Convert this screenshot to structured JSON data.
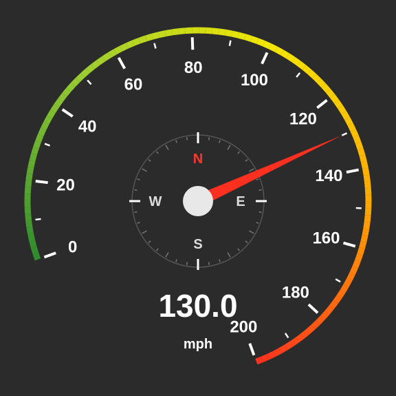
{
  "chart_data": {
    "type": "gauge",
    "title": "",
    "value": 130.0,
    "value_label": "130.0",
    "unit": "mph",
    "range": [
      0,
      200
    ],
    "major_ticks": [
      0,
      20,
      40,
      60,
      80,
      100,
      120,
      140,
      160,
      180,
      200
    ],
    "tick_labels": [
      "0",
      "20",
      "40",
      "60",
      "80",
      "100",
      "120",
      "140",
      "160",
      "180",
      "200"
    ],
    "minor_step": 10,
    "arc_start_deg": 200,
    "arc_end_deg": -70,
    "gradient_stops": [
      {
        "t": 0.0,
        "color": "#2e8b2e"
      },
      {
        "t": 0.25,
        "color": "#9acd32"
      },
      {
        "t": 0.5,
        "color": "#f5e800"
      },
      {
        "t": 0.75,
        "color": "#ffa500"
      },
      {
        "t": 1.0,
        "color": "#ff3020"
      }
    ],
    "compass": {
      "labels": [
        "N",
        "E",
        "S",
        "W"
      ],
      "heading_deg": 0,
      "highlighted": "N"
    }
  }
}
